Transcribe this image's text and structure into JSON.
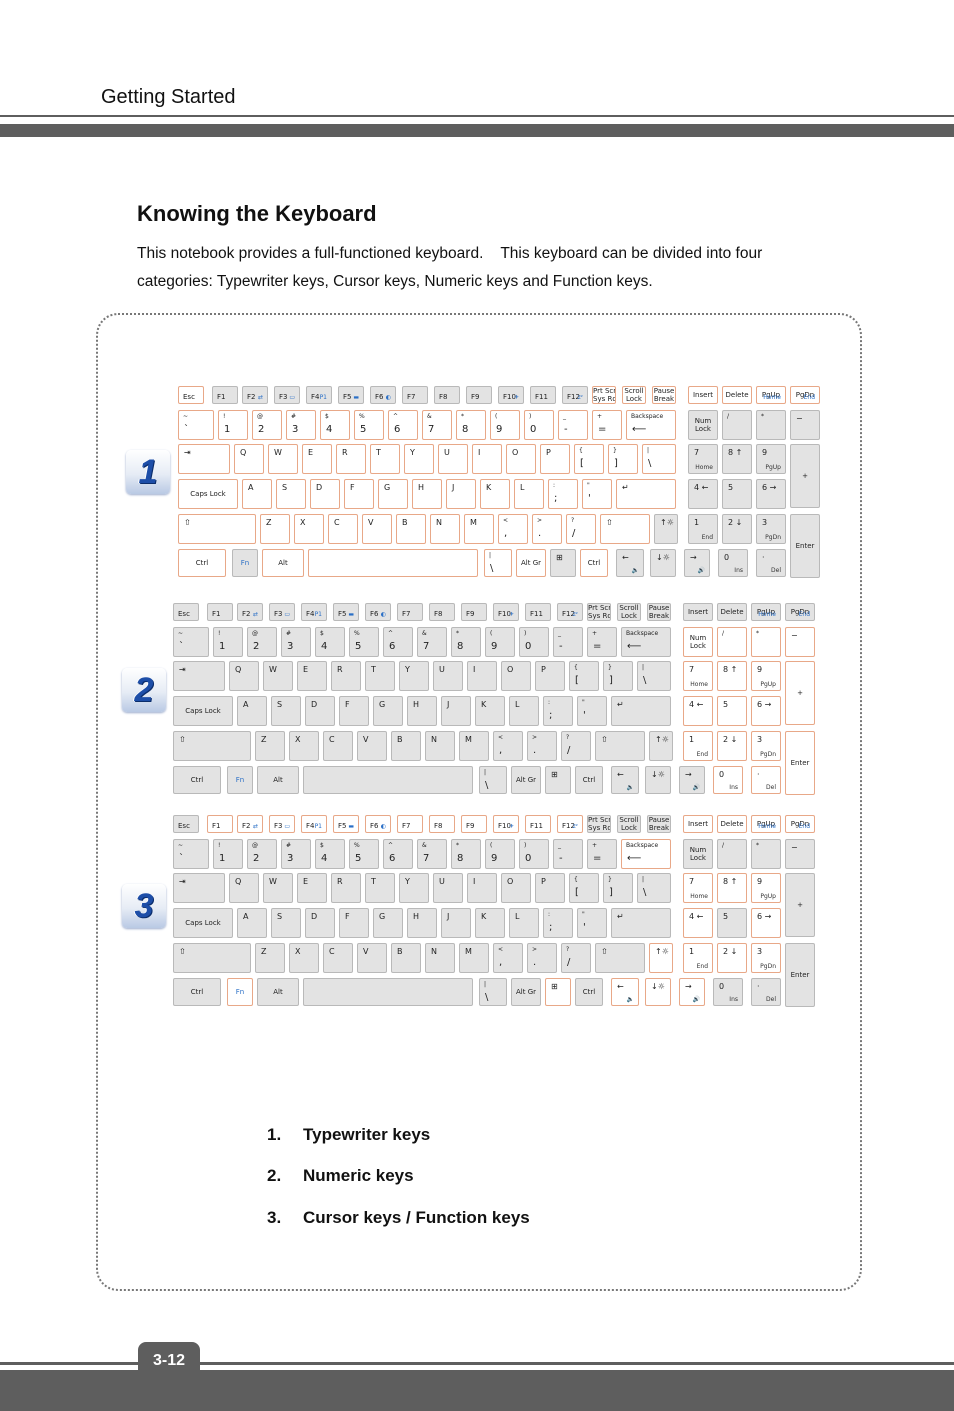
{
  "header": {
    "section": "Getting Started"
  },
  "title": "Knowing the Keyboard",
  "intro": {
    "line1": "This notebook provides a full-functioned keyboard.    This keyboard can be divided into four",
    "line2": "categories: Typewriter keys, Cursor keys, Numeric keys and Function keys."
  },
  "colors": {
    "highlight_border": "#e8a888",
    "key_gray": "#e3e3e3",
    "fn_blue": "#2a6fc6",
    "badge_blue": "#1d4ea8",
    "bar_gray": "#5e5e5e"
  },
  "diagrams": [
    {
      "badge": "1",
      "highlight": "typewriter"
    },
    {
      "badge": "2",
      "highlight": "numeric"
    },
    {
      "badge": "3",
      "highlight": "cursor-function"
    }
  ],
  "keyboard": {
    "rows": [
      [
        {
          "id": "esc",
          "c": "Esc",
          "grp": [
            "typewriter"
          ]
        },
        {
          "id": "f1",
          "c": "F1",
          "grp": [
            "function"
          ]
        },
        {
          "id": "f2",
          "c": "F2",
          "b": "⇄",
          "grp": [
            "function"
          ]
        },
        {
          "id": "f3",
          "c": "F3",
          "b": "▭",
          "grp": [
            "function"
          ]
        },
        {
          "id": "f4",
          "c": "F4",
          "b": "P1",
          "grp": [
            "function"
          ]
        },
        {
          "id": "f5",
          "c": "F5",
          "b": "▬",
          "grp": [
            "function"
          ]
        },
        {
          "id": "f6",
          "c": "F6",
          "b": "◐",
          "grp": [
            "function"
          ]
        },
        {
          "id": "f7",
          "c": "F7",
          "grp": [
            "function"
          ]
        },
        {
          "id": "f8",
          "c": "F8",
          "grp": [
            "function"
          ]
        },
        {
          "id": "f9",
          "c": "F9",
          "grp": [
            "function"
          ]
        },
        {
          "id": "f10",
          "c": "F10",
          "b": "✈",
          "grp": [
            "function"
          ]
        },
        {
          "id": "f11",
          "c": "F11",
          "grp": [
            "function"
          ]
        },
        {
          "id": "f12",
          "c": "F12",
          "b": "zᶻ",
          "grp": [
            "function"
          ]
        },
        {
          "id": "prtscr",
          "c": "Prt Scr\nSys Rq",
          "grp": [
            "typewriter"
          ]
        },
        {
          "id": "scrolllock",
          "c": "Scroll\nLock",
          "grp": [
            "typewriter"
          ]
        },
        {
          "id": "pause",
          "c": "Pause\nBreak",
          "grp": [
            "typewriter"
          ]
        },
        {
          "id": "insert",
          "c": "Insert",
          "grp": [
            "typewriter",
            "cursor-function"
          ]
        },
        {
          "id": "delete",
          "c": "Delete",
          "grp": [
            "typewriter",
            "cursor-function"
          ]
        },
        {
          "id": "pgup",
          "c": "PgUp",
          "b": "Home",
          "grp": [
            "typewriter",
            "cursor-function"
          ]
        },
        {
          "id": "pgdn",
          "c": "PgDn",
          "b": "End",
          "grp": [
            "typewriter",
            "cursor-function"
          ]
        }
      ],
      [
        {
          "id": "grave",
          "t": "~",
          "m": "`",
          "grp": [
            "typewriter"
          ]
        },
        {
          "id": "k1",
          "t": "!",
          "m": "1",
          "grp": [
            "typewriter"
          ]
        },
        {
          "id": "k2",
          "t": "@",
          "m": "2",
          "grp": [
            "typewriter"
          ]
        },
        {
          "id": "k3",
          "t": "#",
          "m": "3",
          "grp": [
            "typewriter"
          ]
        },
        {
          "id": "k4",
          "t": "$",
          "m": "4",
          "grp": [
            "typewriter"
          ]
        },
        {
          "id": "k5",
          "t": "%",
          "m": "5",
          "grp": [
            "typewriter"
          ]
        },
        {
          "id": "k6",
          "t": "^",
          "m": "6",
          "grp": [
            "typewriter"
          ]
        },
        {
          "id": "k7",
          "t": "&",
          "m": "7",
          "grp": [
            "typewriter"
          ]
        },
        {
          "id": "k8",
          "t": "*",
          "m": "8",
          "grp": [
            "typewriter"
          ]
        },
        {
          "id": "k9",
          "t": "(",
          "m": "9",
          "grp": [
            "typewriter"
          ]
        },
        {
          "id": "k0",
          "t": ")",
          "m": "0",
          "grp": [
            "typewriter"
          ]
        },
        {
          "id": "minus",
          "t": "_",
          "m": "-",
          "grp": [
            "typewriter"
          ]
        },
        {
          "id": "equals",
          "t": "+",
          "m": "=",
          "grp": [
            "typewriter"
          ]
        },
        {
          "id": "backspace",
          "t": "Backspace",
          "m": "⟵",
          "grp": [
            "typewriter",
            "cursor-function"
          ]
        },
        {
          "id": "numlock",
          "c": "Num\nLock",
          "grp": [
            "numeric"
          ]
        },
        {
          "id": "npdiv",
          "t": "/",
          "grp": [
            "numeric"
          ]
        },
        {
          "id": "npmul",
          "t": "*",
          "grp": [
            "numeric"
          ]
        },
        {
          "id": "npsub",
          "lg": "−",
          "grp": [
            "numeric"
          ]
        }
      ],
      [
        {
          "id": "tab",
          "lg": "⇥",
          "grp": [
            "typewriter"
          ]
        },
        {
          "id": "q",
          "lg": "Q",
          "grp": [
            "typewriter"
          ]
        },
        {
          "id": "w",
          "lg": "W",
          "grp": [
            "typewriter"
          ]
        },
        {
          "id": "e",
          "lg": "E",
          "grp": [
            "typewriter"
          ]
        },
        {
          "id": "r",
          "lg": "R",
          "grp": [
            "typewriter"
          ]
        },
        {
          "id": "t",
          "lg": "T",
          "grp": [
            "typewriter"
          ]
        },
        {
          "id": "y",
          "lg": "Y",
          "grp": [
            "typewriter"
          ]
        },
        {
          "id": "u",
          "lg": "U",
          "grp": [
            "typewriter"
          ]
        },
        {
          "id": "i",
          "lg": "I",
          "grp": [
            "typewriter"
          ]
        },
        {
          "id": "o",
          "lg": "O",
          "grp": [
            "typewriter"
          ]
        },
        {
          "id": "p",
          "lg": "P",
          "grp": [
            "typewriter"
          ]
        },
        {
          "id": "lbracket",
          "t": "{",
          "m": "[",
          "grp": [
            "typewriter"
          ]
        },
        {
          "id": "rbracket",
          "t": "}",
          "m": "]",
          "grp": [
            "typewriter"
          ]
        },
        {
          "id": "backslash",
          "t": "|",
          "m": "\\",
          "grp": [
            "typewriter"
          ]
        },
        {
          "id": "np7",
          "lg": "7",
          "b2": "Home",
          "grp": [
            "numeric",
            "cursor-function"
          ]
        },
        {
          "id": "np8",
          "lg": "8 ↑",
          "grp": [
            "numeric",
            "cursor-function"
          ]
        },
        {
          "id": "np9",
          "lg": "9",
          "b2": "PgUp",
          "grp": [
            "numeric",
            "cursor-function"
          ]
        },
        {
          "id": "npadd",
          "c": "+",
          "grp": [
            "numeric"
          ]
        }
      ],
      [
        {
          "id": "capslock",
          "c": "Caps Lock",
          "grp": [
            "typewriter"
          ]
        },
        {
          "id": "a",
          "lg": "A",
          "grp": [
            "typewriter"
          ]
        },
        {
          "id": "s",
          "lg": "S",
          "grp": [
            "typewriter"
          ]
        },
        {
          "id": "d",
          "lg": "D",
          "grp": [
            "typewriter"
          ]
        },
        {
          "id": "f",
          "lg": "F",
          "grp": [
            "typewriter"
          ]
        },
        {
          "id": "g",
          "lg": "G",
          "grp": [
            "typewriter"
          ]
        },
        {
          "id": "h",
          "lg": "H",
          "grp": [
            "typewriter"
          ]
        },
        {
          "id": "j",
          "lg": "J",
          "grp": [
            "typewriter"
          ]
        },
        {
          "id": "k",
          "lg": "K",
          "grp": [
            "typewriter"
          ]
        },
        {
          "id": "l",
          "lg": "L",
          "grp": [
            "typewriter"
          ]
        },
        {
          "id": "semicolon",
          "t": ":",
          "m": ";",
          "grp": [
            "typewriter"
          ]
        },
        {
          "id": "quote",
          "t": "\"",
          "m": "'",
          "grp": [
            "typewriter"
          ]
        },
        {
          "id": "enter",
          "lg": "↵",
          "grp": [
            "typewriter"
          ]
        },
        {
          "id": "np4",
          "lg": "4 ←",
          "grp": [
            "numeric",
            "cursor-function"
          ]
        },
        {
          "id": "np5",
          "lg": "5",
          "grp": [
            "numeric"
          ]
        },
        {
          "id": "np6",
          "lg": "6 →",
          "grp": [
            "numeric",
            "cursor-function"
          ]
        }
      ],
      [
        {
          "id": "lshift",
          "lg": "⇧",
          "grp": [
            "typewriter"
          ]
        },
        {
          "id": "z",
          "lg": "Z",
          "grp": [
            "typewriter"
          ]
        },
        {
          "id": "x",
          "lg": "X",
          "grp": [
            "typewriter"
          ]
        },
        {
          "id": "c",
          "lg": "C",
          "grp": [
            "typewriter"
          ]
        },
        {
          "id": "v",
          "lg": "V",
          "grp": [
            "typewriter"
          ]
        },
        {
          "id": "b",
          "lg": "B",
          "grp": [
            "typewriter"
          ]
        },
        {
          "id": "n",
          "lg": "N",
          "grp": [
            "typewriter"
          ]
        },
        {
          "id": "m",
          "lg": "M",
          "grp": [
            "typewriter"
          ]
        },
        {
          "id": "comma",
          "t": "<",
          "m": ",",
          "grp": [
            "typewriter"
          ]
        },
        {
          "id": "period",
          "t": ">",
          "m": ".",
          "grp": [
            "typewriter"
          ]
        },
        {
          "id": "slash",
          "t": "?",
          "m": "/",
          "grp": [
            "typewriter"
          ]
        },
        {
          "id": "rshift",
          "lg": "⇧",
          "grp": [
            "typewriter"
          ]
        },
        {
          "id": "up",
          "lg": "↑☼",
          "grp": [
            "cursor-function"
          ]
        },
        {
          "id": "np1",
          "lg": "1",
          "b2": "End",
          "grp": [
            "numeric",
            "cursor-function"
          ]
        },
        {
          "id": "np2",
          "lg": "2 ↓",
          "grp": [
            "numeric",
            "cursor-function"
          ]
        },
        {
          "id": "np3",
          "lg": "3",
          "b2": "PgDn",
          "grp": [
            "numeric",
            "cursor-function"
          ]
        },
        {
          "id": "npenter",
          "c": "Enter",
          "grp": [
            "numeric"
          ]
        }
      ],
      [
        {
          "id": "lctrl",
          "c": "Ctrl",
          "grp": [
            "typewriter"
          ]
        },
        {
          "id": "fn",
          "c": "Fn",
          "blue": true,
          "grp": [
            "cursor-function"
          ]
        },
        {
          "id": "lalt",
          "c": "Alt",
          "grp": [
            "typewriter"
          ]
        },
        {
          "id": "space",
          "c": "",
          "grp": [
            "typewriter"
          ]
        },
        {
          "id": "backslash2",
          "t": "|",
          "m": "\\",
          "grp": [
            "typewriter"
          ]
        },
        {
          "id": "altgr",
          "c": "Alt Gr",
          "grp": [
            "typewriter"
          ]
        },
        {
          "id": "win",
          "lg": "⊞",
          "grp": [
            "cursor-function"
          ]
        },
        {
          "id": "rctrl",
          "c": "Ctrl",
          "grp": [
            "typewriter"
          ]
        },
        {
          "id": "left",
          "lg": "←",
          "b": "🔈",
          "grp": [
            "cursor-function"
          ]
        },
        {
          "id": "down",
          "lg": "↓☼",
          "grp": [
            "cursor-function"
          ]
        },
        {
          "id": "right",
          "lg": "→",
          "b": "🔊",
          "grp": [
            "cursor-function"
          ]
        },
        {
          "id": "np0",
          "lg": "0",
          "b2": "Ins",
          "grp": [
            "numeric"
          ]
        },
        {
          "id": "npdot",
          "lg": "·",
          "b2": "Del",
          "grp": [
            "numeric"
          ]
        }
      ]
    ]
  },
  "legend": [
    {
      "num": "1.",
      "label": "Typewriter keys"
    },
    {
      "num": "2.",
      "label": "Numeric keys"
    },
    {
      "num": "3.",
      "label": "Cursor keys / Function keys"
    }
  ],
  "footer": {
    "page": "3-12"
  }
}
